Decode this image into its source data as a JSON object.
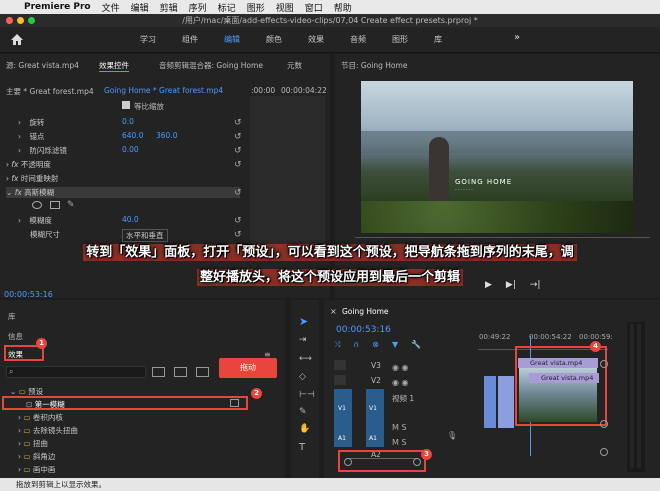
{
  "menubar": {
    "app": "Premiere Pro",
    "items": [
      "文件",
      "编辑",
      "剪辑",
      "序列",
      "标记",
      "图形",
      "视图",
      "窗口",
      "帮助"
    ]
  },
  "window_title": "/用户/mac/桌面/add-effects-video-clips/07,04 Create effect presets.prproj *",
  "workspaces": {
    "items": [
      "学习",
      "组件",
      "编辑",
      "颜色",
      "效果",
      "音频",
      "图形",
      "库"
    ],
    "active": "编辑",
    "more": "»"
  },
  "source_panel": {
    "tab_source": "源: Great vista.mp4",
    "tab_effect_controls": "效果控件",
    "tab_audio_mixer": "音频剪辑混合器: Going Home",
    "tab_meta": "元数",
    "master": "主要 * Great forest.mp4",
    "seq": "Going Home * Great forest.mp4",
    "time_a": ":00:00",
    "time_b": "00:00:04:22",
    "uniform_scale": "等比缩放",
    "rows": [
      {
        "label": "旋转",
        "value": "0.0"
      },
      {
        "label": "锚点",
        "value": "640.0",
        "value2": "360.0"
      },
      {
        "label": "防闪烁滤镜",
        "value": "0.00"
      },
      {
        "label": "不透明度",
        "value": ""
      },
      {
        "label": "时间重映射",
        "value": ""
      },
      {
        "label": "高斯模糊",
        "value": ""
      },
      {
        "label": "模糊度",
        "value": "40.0"
      },
      {
        "label": "模糊尺寸",
        "value": "水平和垂直"
      }
    ],
    "timecode": "00:00:53:16"
  },
  "program": {
    "title": "节目: Going Home",
    "overlay_text": "GOING HOME",
    "overlay_sub": "- - - - - - -"
  },
  "caption": {
    "line1": "转到「效果」面板，打开「预设」，可以看到这个预设，把导航条拖到序列的末尾，调",
    "line2": "整好播放头，将这个预设应用到最后一个剪辑"
  },
  "left_bottom": {
    "lib": "库",
    "info": "信息",
    "effects": "效果",
    "drag_tag": "拖动",
    "tree": [
      {
        "label": "预设",
        "level": 0,
        "open": true
      },
      {
        "label": "第一模糊",
        "level": 1,
        "selected": true
      },
      {
        "label": "卷积内核",
        "level": 1
      },
      {
        "label": "去除镜头扭曲",
        "level": 1
      },
      {
        "label": "扭曲",
        "level": 1
      },
      {
        "label": "斜角边",
        "level": 1
      },
      {
        "label": "画中画",
        "level": 1
      }
    ]
  },
  "timeline": {
    "title": "Going Home",
    "timecode": "00:00:53:16",
    "ruler": [
      "00:49:22",
      "00:00:54:22",
      "00:00:59:"
    ],
    "tracks": [
      {
        "name": "V3"
      },
      {
        "name": "V2"
      },
      {
        "name": "V1",
        "label": "视频 1"
      },
      {
        "name": "A1"
      },
      {
        "name": "A2"
      }
    ],
    "clips": [
      "Great vista.mp4",
      "Great vista.mp4"
    ]
  },
  "badges": [
    "1",
    "2",
    "3",
    "4"
  ],
  "status_bar": "拖放到剪辑上以显示效果。",
  "colors": {
    "accent": "#4d9bff",
    "badge": "#e8453c",
    "clip": "#a89bd6"
  }
}
